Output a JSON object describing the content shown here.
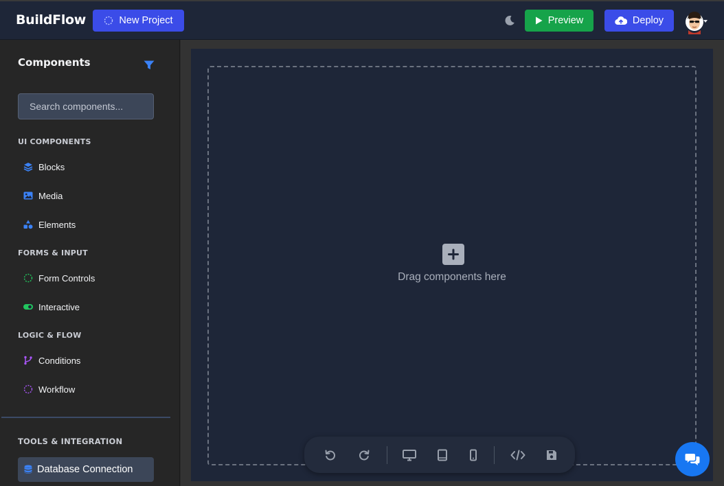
{
  "header": {
    "brand": "BuildFlow",
    "new_project_label": "New Project",
    "preview_label": "Preview",
    "deploy_label": "Deploy"
  },
  "sidebar": {
    "title": "Components",
    "search_placeholder": "Search components...",
    "sections": [
      {
        "label": "UI COMPONENTS",
        "items": [
          {
            "label": "Blocks",
            "icon": "layers-icon"
          },
          {
            "label": "Media",
            "icon": "image-icon"
          },
          {
            "label": "Elements",
            "icon": "shapes-icon"
          }
        ]
      },
      {
        "label": "FORMS & INPUT",
        "items": [
          {
            "label": "Form Controls",
            "icon": "dashed-circle-icon"
          },
          {
            "label": "Interactive",
            "icon": "toggle-icon"
          }
        ]
      },
      {
        "label": "LOGIC & FLOW",
        "items": [
          {
            "label": "Conditions",
            "icon": "branch-icon"
          },
          {
            "label": "Workflow",
            "icon": "dashed-circle-icon"
          }
        ]
      },
      {
        "label": "TOOLS & INTEGRATION",
        "items": [
          {
            "label": "Database Connection",
            "icon": "database-icon"
          }
        ]
      }
    ]
  },
  "canvas": {
    "drop_text": "Drag components here"
  },
  "colors": {
    "accent_blue": "#3b4ce8",
    "preview_green": "#16a34a",
    "canvas_bg": "#1e2638",
    "chat_blue": "#1877f2"
  }
}
